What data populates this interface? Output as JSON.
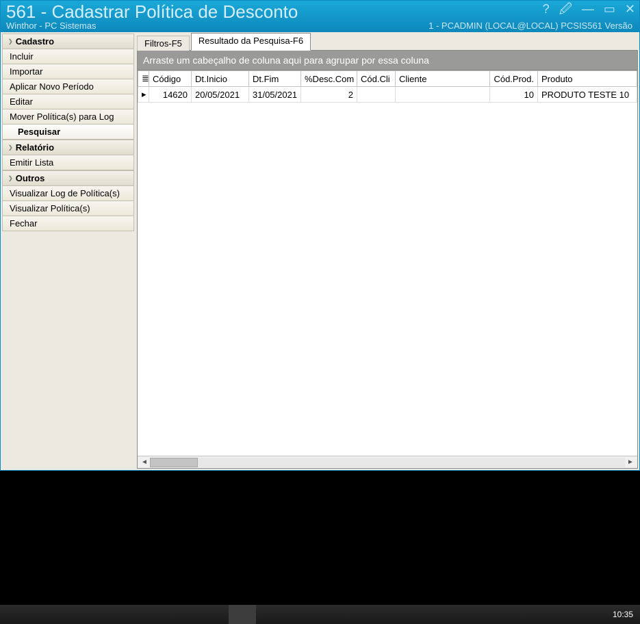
{
  "titlebar": {
    "main_title": "561 - Cadastrar Política de Desconto",
    "subtitle_left": "Winthor - PC Sistemas",
    "subtitle_right": "1 - PCADMIN (LOCAL@LOCAL)   PCSIS561   Versão",
    "help_icon": "?",
    "pin_icon": "🖉",
    "min_icon": "—",
    "max_icon": "▭",
    "close_icon": "✕"
  },
  "sidebar": {
    "groups": [
      {
        "header": "Cadastro",
        "items": [
          "Incluir",
          "Importar",
          "Aplicar Novo Período",
          "Editar",
          "Mover Política(s) para Log"
        ],
        "selected_item": "Pesquisar"
      },
      {
        "header": "Relatório",
        "items": [
          "Emitir Lista"
        ]
      },
      {
        "header": "Outros",
        "items": [
          "Visualizar Log de Política(s)",
          "Visualizar Política(s)",
          "Fechar"
        ]
      }
    ]
  },
  "tabs": {
    "filtros": "Filtros-F5",
    "resultado": "Resultado da Pesquisa-F6"
  },
  "grid": {
    "group_by_hint": "Arraste um cabeçalho de coluna aqui para agrupar por essa coluna",
    "columns": [
      "Código",
      "Dt.Inicio",
      "Dt.Fim",
      "%Desc.Com",
      "Cód.Cli",
      "Cliente",
      "Cód.Prod.",
      "Produto"
    ],
    "rows": [
      {
        "codigo": "14620",
        "dt_inicio": "20/05/2021",
        "dt_fim": "31/05/2021",
        "desc_com": "2",
        "cod_cli": "",
        "cliente": "",
        "cod_prod": "10",
        "produto": "PRODUTO TESTE 10"
      }
    ]
  },
  "taskbar": {
    "clock": "10:35"
  }
}
